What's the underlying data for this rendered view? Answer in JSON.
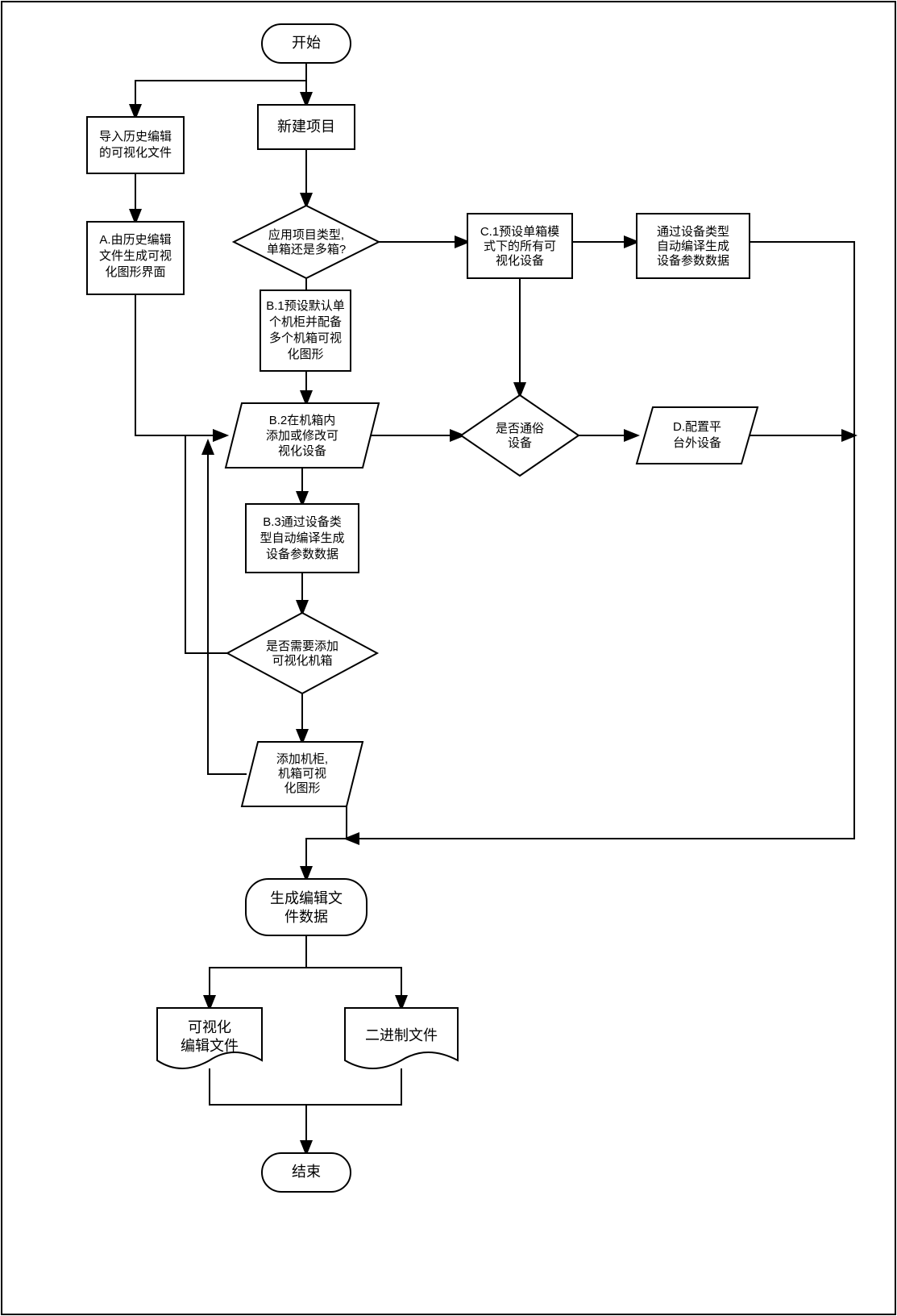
{
  "flow": {
    "start": "开始",
    "end": "结束",
    "import_history": [
      "导入历史编辑",
      "的可视化文件"
    ],
    "gen_hist_ui": [
      "A.由历史编辑",
      "文件生成可视",
      "化图形界面"
    ],
    "new_project": "新建项目",
    "project_type": [
      "应用项目类型,",
      "单箱还是多箱?"
    ],
    "preset_c1": [
      "C.1预设单箱模",
      "式下的所有可",
      "视化设备"
    ],
    "auto_compile": [
      "通过设备类型",
      "自动编译生成",
      "设备参数数据"
    ],
    "preset_b1": [
      "B.1预设默认单",
      "个机柜并配备",
      "多个机箱可视",
      "化图形"
    ],
    "edit_b2": [
      "B.2在机箱内",
      "添加或修改可",
      "视化设备"
    ],
    "is_generic": [
      "是否通俗",
      "设备"
    ],
    "config_d": [
      "D.配置平",
      "台外设备"
    ],
    "compile_b3": [
      "B.3通过设备类",
      "型自动编译生成",
      "设备参数数据"
    ],
    "need_add_box": [
      "是否需要添加",
      "可视化机箱"
    ],
    "add_cabinet": [
      "添加机柜,",
      "机箱可视",
      "化图形"
    ],
    "gen_edit_data": [
      "生成编辑文",
      "件数据"
    ],
    "vis_edit_file": [
      "可视化",
      "编辑文件"
    ],
    "binary_file": "二进制文件"
  }
}
